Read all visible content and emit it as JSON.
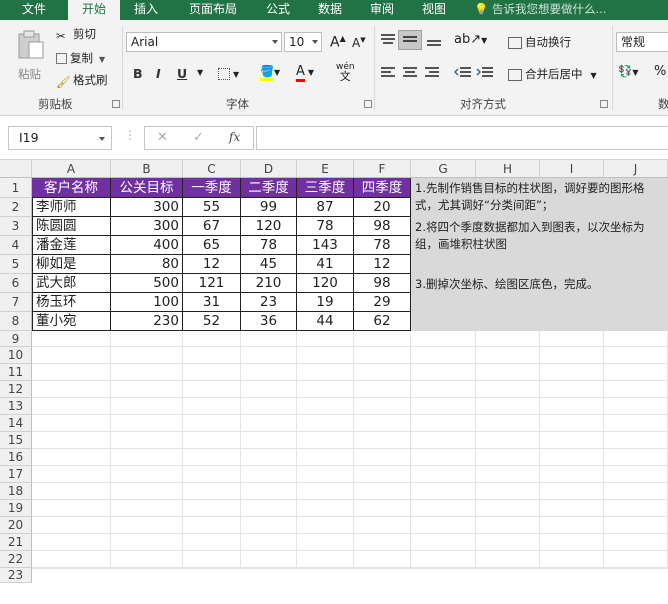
{
  "tabs": {
    "file": "文件",
    "home": "开始",
    "insert": "插入",
    "layout": "页面布局",
    "formulas": "公式",
    "data": "数据",
    "review": "审阅",
    "view": "视图"
  },
  "tellme": "告诉我您想要做什么...",
  "ribbon": {
    "clipboard": {
      "paste": "粘贴",
      "cut": "剪切",
      "copy": "复制",
      "format_painter": "格式刷",
      "label": "剪贴板"
    },
    "font": {
      "name": "Arial",
      "size": "10",
      "bold": "B",
      "italic": "I",
      "underline": "U",
      "grow": "A",
      "shrink": "A",
      "font_color": "A",
      "wen": "wén",
      "wen_sub": "文",
      "label": "字体"
    },
    "alignment": {
      "wrap": "自动换行",
      "merge": "合并后居中",
      "label": "对齐方式"
    },
    "number": {
      "format": "常规",
      "percent": "%",
      "label": "数"
    }
  },
  "formula_bar": {
    "name_box": "I19",
    "cancel": "✕",
    "enter": "✓",
    "fx": "fx",
    "content": ""
  },
  "columns": [
    "A",
    "B",
    "C",
    "D",
    "E",
    "F",
    "G",
    "H",
    "I",
    "J"
  ],
  "rows": [
    "1",
    "2",
    "3",
    "4",
    "5",
    "6",
    "7",
    "8",
    "9",
    "10",
    "11",
    "12",
    "13",
    "14",
    "15",
    "16",
    "17",
    "18",
    "19",
    "20",
    "21",
    "22",
    "23"
  ],
  "table": {
    "headers": [
      "客户名称",
      "公关目标",
      "一季度",
      "二季度",
      "三季度",
      "四季度"
    ],
    "rows": [
      [
        "李师师",
        "300",
        "55",
        "99",
        "87",
        "20"
      ],
      [
        "陈圆圆",
        "300",
        "67",
        "120",
        "78",
        "98"
      ],
      [
        "潘金莲",
        "400",
        "65",
        "78",
        "143",
        "78"
      ],
      [
        "柳如是",
        "80",
        "12",
        "45",
        "41",
        "12"
      ],
      [
        "武大郎",
        "500",
        "121",
        "210",
        "120",
        "98"
      ],
      [
        "杨玉环",
        "100",
        "31",
        "23",
        "19",
        "29"
      ],
      [
        "董小宛",
        "230",
        "52",
        "36",
        "44",
        "62"
      ]
    ]
  },
  "notes": [
    "1.先制作销售目标的柱状图，调好要的图形格式，尤其调好“分类间距”；",
    "2.将四个季度数据都加入到图表，以次坐标为组，画堆积柱状图",
    "3.删掉次坐标、绘图区底色，完成。"
  ],
  "colors": {
    "accent": "#217346",
    "header_fill": "#7030a0",
    "note_fill": "#d9d9d9"
  }
}
